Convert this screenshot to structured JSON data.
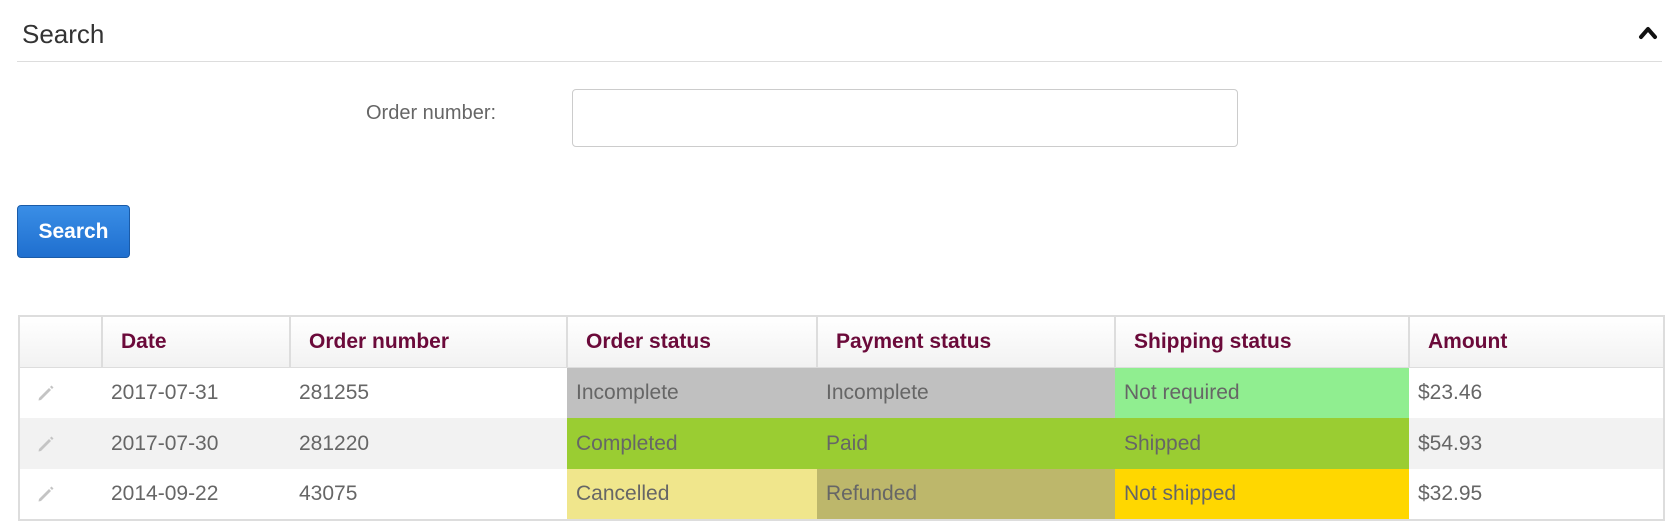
{
  "panel": {
    "title": "Search",
    "collapse_icon": "chevron-up-icon"
  },
  "form": {
    "order_number_label": "Order number:",
    "order_number_value": "",
    "order_number_placeholder": ""
  },
  "search_button_label": "Search",
  "table": {
    "columns": [
      "",
      "Date",
      "Order number",
      "Order status",
      "Payment status",
      "Shipping status",
      "Amount"
    ],
    "rows": [
      {
        "edit_icon": "pencil-icon",
        "date": "2017-07-31",
        "order_number": "281255",
        "order_status": "Incomplete",
        "payment_status": "Incomplete",
        "shipping_status": "Not required",
        "amount": "$23.46",
        "order_status_color": "#c0c0c0",
        "payment_status_color": "#c0c0c0",
        "shipping_status_color": "#90ee90"
      },
      {
        "edit_icon": "pencil-icon",
        "date": "2017-07-30",
        "order_number": "281220",
        "order_status": "Completed",
        "payment_status": "Paid",
        "shipping_status": "Shipped",
        "amount": "$54.93",
        "order_status_color": "#9acd32",
        "payment_status_color": "#9acd32",
        "shipping_status_color": "#9acd32"
      },
      {
        "edit_icon": "pencil-icon",
        "date": "2014-09-22",
        "order_number": "43075",
        "order_status": "Cancelled",
        "payment_status": "Refunded",
        "shipping_status": "Not shipped",
        "amount": "$32.95",
        "order_status_color": "#f0e68c",
        "payment_status_color": "#bdb76b",
        "shipping_status_color": "#ffd700"
      }
    ]
  },
  "colors": {
    "header_text": "#6b0a3a",
    "button_bg": "#1f6fcf",
    "body_text": "#666666"
  }
}
